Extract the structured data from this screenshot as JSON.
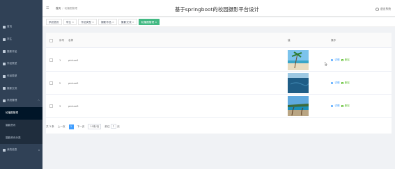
{
  "sidebar": {
    "items": [
      {
        "label": "首页",
        "icon": "home-icon"
      },
      {
        "label": "学生",
        "icon": "user-icon"
      },
      {
        "label": "摄影作品",
        "icon": "camera-icon"
      },
      {
        "label": "作品类型",
        "icon": "grid-icon"
      },
      {
        "label": "作品类型",
        "icon": "folder-icon"
      },
      {
        "label": "摄影交流",
        "icon": "chat-icon"
      },
      {
        "label": "系统管理",
        "icon": "settings-icon",
        "expanded": true
      }
    ],
    "submenu": [
      "轮播图管理",
      "摄影资讯",
      "摄影资讯分类"
    ],
    "active_submenu": "轮播图管理",
    "last_item": {
      "label": "我的信息",
      "icon": "profile-icon"
    }
  },
  "header": {
    "breadcrumb_home": "首页",
    "breadcrumb_sep": "/",
    "breadcrumb_current": "轮播图管理",
    "title": "基于springboot的校园摄影平台设计",
    "logout": "退出系统"
  },
  "tabs": [
    {
      "label": "系统首页",
      "closable": false,
      "active": false
    },
    {
      "label": "学生",
      "closable": true,
      "active": false
    },
    {
      "label": "作品类型",
      "closable": true,
      "active": false
    },
    {
      "label": "摄影作品",
      "closable": true,
      "active": false
    },
    {
      "label": "摄影交流",
      "closable": true,
      "active": false
    },
    {
      "label": "轮播图管理",
      "closable": true,
      "active": true
    }
  ],
  "table": {
    "headers": {
      "index": "序号",
      "name": "名称",
      "value": "值",
      "actions": "操作"
    },
    "rows": [
      {
        "index": "1",
        "name": "picture1",
        "view": "详情",
        "delete": "删除",
        "image": "palm-beach"
      },
      {
        "index": "2",
        "name": "picture2",
        "view": "详情",
        "delete": "删除",
        "image": "ocean"
      },
      {
        "index": "3",
        "name": "picture3",
        "view": "详情",
        "delete": "删除",
        "image": "tropical-beach"
      }
    ]
  },
  "pagination": {
    "total": "共 3 条",
    "prev": "上一页",
    "current": "1",
    "next": "下一页",
    "page_size": "10条/页",
    "goto": "前往",
    "goto_value": "1",
    "page_unit": "页"
  },
  "colors": {
    "sidebar_bg": "#304156",
    "active_tab": "#42b983",
    "link": "#409eff",
    "delete": "#67c23a"
  }
}
